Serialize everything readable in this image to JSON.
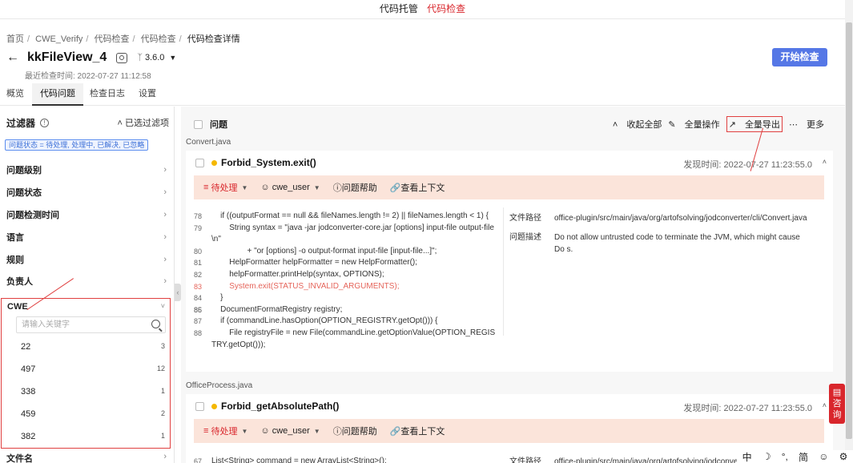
{
  "topnav": {
    "items": [
      {
        "label": "代码托管",
        "active": false
      },
      {
        "label": "代码检查",
        "active": true
      }
    ]
  },
  "breadcrumb": [
    "首页",
    "CWE_Verify",
    "代码检查",
    "代码检查",
    "代码检查详情"
  ],
  "project": {
    "name": "kkFileView_4",
    "branch": "3.6.0",
    "last_check": "最近检查时间: 2022-07-27 11:12:58",
    "start_button": "开始检查"
  },
  "tabs": [
    "概览",
    "代码问题",
    "检查日志",
    "设置"
  ],
  "sidebar": {
    "filter_title": "过滤器",
    "selected_filters": "已选过滤项",
    "status_tag": "问题状态 = 待处理, 处理中, 已解决, 已忽略",
    "items": [
      "问题级别",
      "问题状态",
      "问题检测时间",
      "语言",
      "规则",
      "负责人"
    ],
    "cwe_title": "CWE",
    "cwe_search_placeholder": "请输入关键字",
    "cwe_list": [
      {
        "id": "22",
        "count": "3"
      },
      {
        "id": "497",
        "count": "12"
      },
      {
        "id": "338",
        "count": "1"
      },
      {
        "id": "459",
        "count": "2"
      },
      {
        "id": "382",
        "count": "1"
      }
    ],
    "file_name": "文件名"
  },
  "main": {
    "issues_label": "问题",
    "actions": {
      "collapse_all": "收起全部",
      "bulk_ops": "全量操作",
      "export_all": "全量导出",
      "more": "更多"
    },
    "file1": "Convert.java",
    "file2": "OfficeProcess.java",
    "issue1": {
      "rule": "Forbid_System.exit()",
      "found": "发现时间: 2022-07-27 11:23:55.0",
      "status": "待处理",
      "assignee": "cwe_user",
      "help": "问题帮助",
      "context": "查看上下文",
      "code": [
        {
          "ln": "78",
          "text": "    if ((outputFormat == null && fileNames.length != 2) || fileNames.length < 1) {",
          "hl": false
        },
        {
          "ln": "79",
          "text": "        String syntax = \"java -jar jodconverter-core.jar [options] input-file output-file",
          "hl": false
        },
        {
          "ln": "",
          "text": "\\n\"",
          "hl": false
        },
        {
          "ln": "80",
          "text": "                + \"or [options] -o output-format input-file [input-file...]\";",
          "hl": false
        },
        {
          "ln": "81",
          "text": "        HelpFormatter helpFormatter = new HelpFormatter();",
          "hl": false
        },
        {
          "ln": "82",
          "text": "        helpFormatter.printHelp(syntax, OPTIONS);",
          "hl": false
        },
        {
          "ln": "83",
          "text": "        System.exit(STATUS_INVALID_ARGUMENTS);",
          "hl": true
        },
        {
          "ln": "84",
          "text": "    }",
          "hl": false
        },
        {
          "ln": "85",
          "text": "",
          "hl": false
        },
        {
          "ln": "86",
          "text": "    DocumentFormatRegistry registry;",
          "hl": false
        },
        {
          "ln": "87",
          "text": "    if (commandLine.hasOption(OPTION_REGISTRY.getOpt())) {",
          "hl": false
        },
        {
          "ln": "88",
          "text": "        File registryFile = new File(commandLine.getOptionValue(OPTION_REGIS",
          "hl": false
        },
        {
          "ln": "",
          "text": "TRY.getOpt()));",
          "hl": false
        }
      ],
      "path_label": "文件路径",
      "path": "office-plugin/src/main/java/org/artofsolving/jodconverter/cli/Convert.java",
      "desc_label": "问题描述",
      "desc": "Do not allow untrusted code to terminate the JVM, which might cause Do s."
    },
    "issue2": {
      "rule": "Forbid_getAbsolutePath()",
      "found": "发现时间: 2022-07-27 11:23:55.0",
      "status": "待处理",
      "assignee": "cwe_user",
      "help": "问题帮助",
      "context": "查看上下文",
      "line_ln": "67",
      "line_text": "    List<String> command = new ArrayList<String>();",
      "path_label": "文件路径",
      "path": "office-plugin/src/main/java/org/artofsolving/jodconver"
    }
  },
  "consult": "咨询",
  "tray": [
    "中",
    "☽",
    "°,",
    "简",
    "☺",
    "⚙"
  ]
}
